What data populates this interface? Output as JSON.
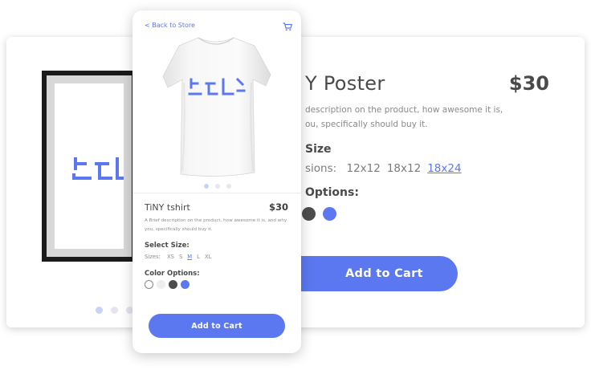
{
  "desktop": {
    "title": "Y Poster",
    "price": "$30",
    "description": "description on the product, how awesome it is, ou, specifically should buy it.",
    "select_size_label": "Size",
    "size_prefix": "sions:",
    "sizes": [
      "12x12",
      "18x12",
      "18x24"
    ],
    "selected_size": "18x24",
    "color_label": "Options:",
    "swatches": [
      "#4d4d4d",
      "#5b78f0"
    ],
    "add_to_cart": "Add to Cart",
    "carousel_dots": 3,
    "carousel_active": 0
  },
  "mobile": {
    "back_link": "< Back to Store",
    "cart_icon": "cart-icon",
    "title": "TiNY tshirt",
    "price": "$30",
    "description": "A Brief description on the product, how awesome it is, and why you, specifically should buy it.",
    "select_size_label": "Select Size:",
    "size_prefix": "Sizes:",
    "sizes": [
      "XS",
      "S",
      "M",
      "L",
      "XL"
    ],
    "selected_size": "M",
    "color_label": "Color Options:",
    "swatches": [
      "#ffffff",
      "#eeeeee",
      "#4d4d4d",
      "#5b78f0"
    ],
    "add_to_cart": "Add to Cart",
    "carousel_dots": 3,
    "carousel_active": 0
  },
  "colors": {
    "accent": "#5b78f0",
    "text": "#4a4a4a",
    "muted": "#8d8d8d"
  }
}
